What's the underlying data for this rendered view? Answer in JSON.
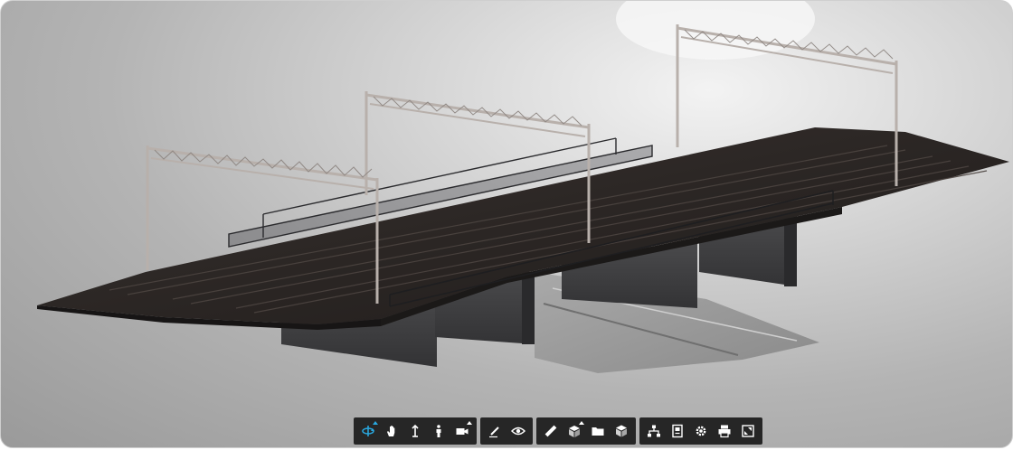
{
  "viewer": {
    "scene": "railway-bridge-3d-model"
  },
  "colors": {
    "active_tool": "#29a8e0",
    "toolbar_bg": "#262626",
    "icon": "#ffffff"
  },
  "toolbar": {
    "groups": [
      {
        "tools": [
          {
            "icon": "orbit-icon",
            "active": true
          },
          {
            "icon": "pan-hand-icon"
          },
          {
            "icon": "zoom-arrows-icon"
          },
          {
            "icon": "first-person-icon"
          },
          {
            "icon": "camera-icon"
          }
        ]
      },
      {
        "tools": [
          {
            "icon": "markup-pen-icon"
          },
          {
            "icon": "eye-view-icon"
          }
        ]
      },
      {
        "tools": [
          {
            "icon": "measure-ruler-icon"
          },
          {
            "icon": "section-box-icon"
          },
          {
            "icon": "folder-icon"
          },
          {
            "icon": "cube-explode-icon"
          }
        ]
      },
      {
        "tools": [
          {
            "icon": "model-tree-icon"
          },
          {
            "icon": "document-properties-icon"
          },
          {
            "icon": "settings-gear-icon"
          },
          {
            "icon": "print-icon"
          },
          {
            "icon": "fullscreen-icon"
          }
        ]
      }
    ]
  }
}
